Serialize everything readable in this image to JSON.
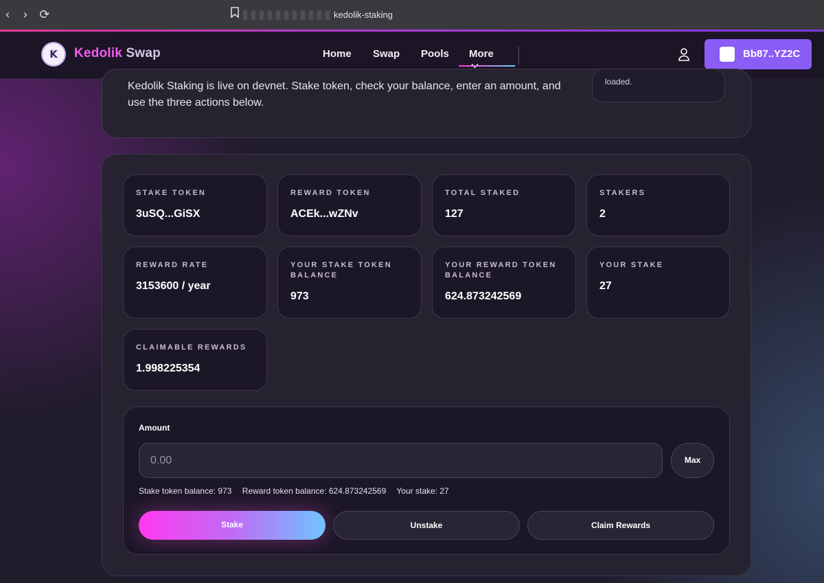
{
  "browser": {
    "back": "‹",
    "forward": "›",
    "reload": "⟳",
    "bookmark_icon": "bookmark-icon",
    "url": "kedolik-staking"
  },
  "header": {
    "brand_first": "Kedolik",
    "brand_second": "Swap",
    "logo_text": "K",
    "nav": [
      "Home",
      "Swap",
      "Pools",
      "More"
    ],
    "more_chevron": "⌄",
    "wallet_label": "Bb87..YZ2C"
  },
  "info": {
    "text": "Kedolik Staking is live on devnet. Stake token, check your balance, enter an amount, and use the three actions below.",
    "status_fragment": "loaded."
  },
  "stats": [
    {
      "label": "STAKE TOKEN",
      "value": "3uSQ...GiSX"
    },
    {
      "label": "REWARD TOKEN",
      "value": "ACEk...wZNv"
    },
    {
      "label": "TOTAL STAKED",
      "value": "127"
    },
    {
      "label": "STAKERS",
      "value": "2"
    },
    {
      "label": "REWARD RATE",
      "value": "3153600 / year"
    },
    {
      "label": "YOUR STAKE TOKEN BALANCE",
      "value": "973"
    },
    {
      "label": "YOUR REWARD TOKEN BALANCE",
      "value": "624.873242569"
    },
    {
      "label": "YOUR STAKE",
      "value": "27"
    },
    {
      "label": "CLAIMABLE REWARDS",
      "value": "1.998225354"
    }
  ],
  "amount": {
    "label": "Amount",
    "placeholder": "0.00",
    "max_label": "Max",
    "stake_balance": "Stake token balance: 973",
    "reward_balance": "Reward token balance: 624.873242569",
    "your_stake": "Your stake: 27"
  },
  "actions": {
    "stake": "Stake",
    "unstake": "Unstake",
    "claim": "Claim Rewards"
  },
  "colors": {
    "accent": "#8b5cf6",
    "brand_pink": "#f15ef0",
    "card_bg": "#1c1727",
    "panel_bg": "#27222f"
  }
}
